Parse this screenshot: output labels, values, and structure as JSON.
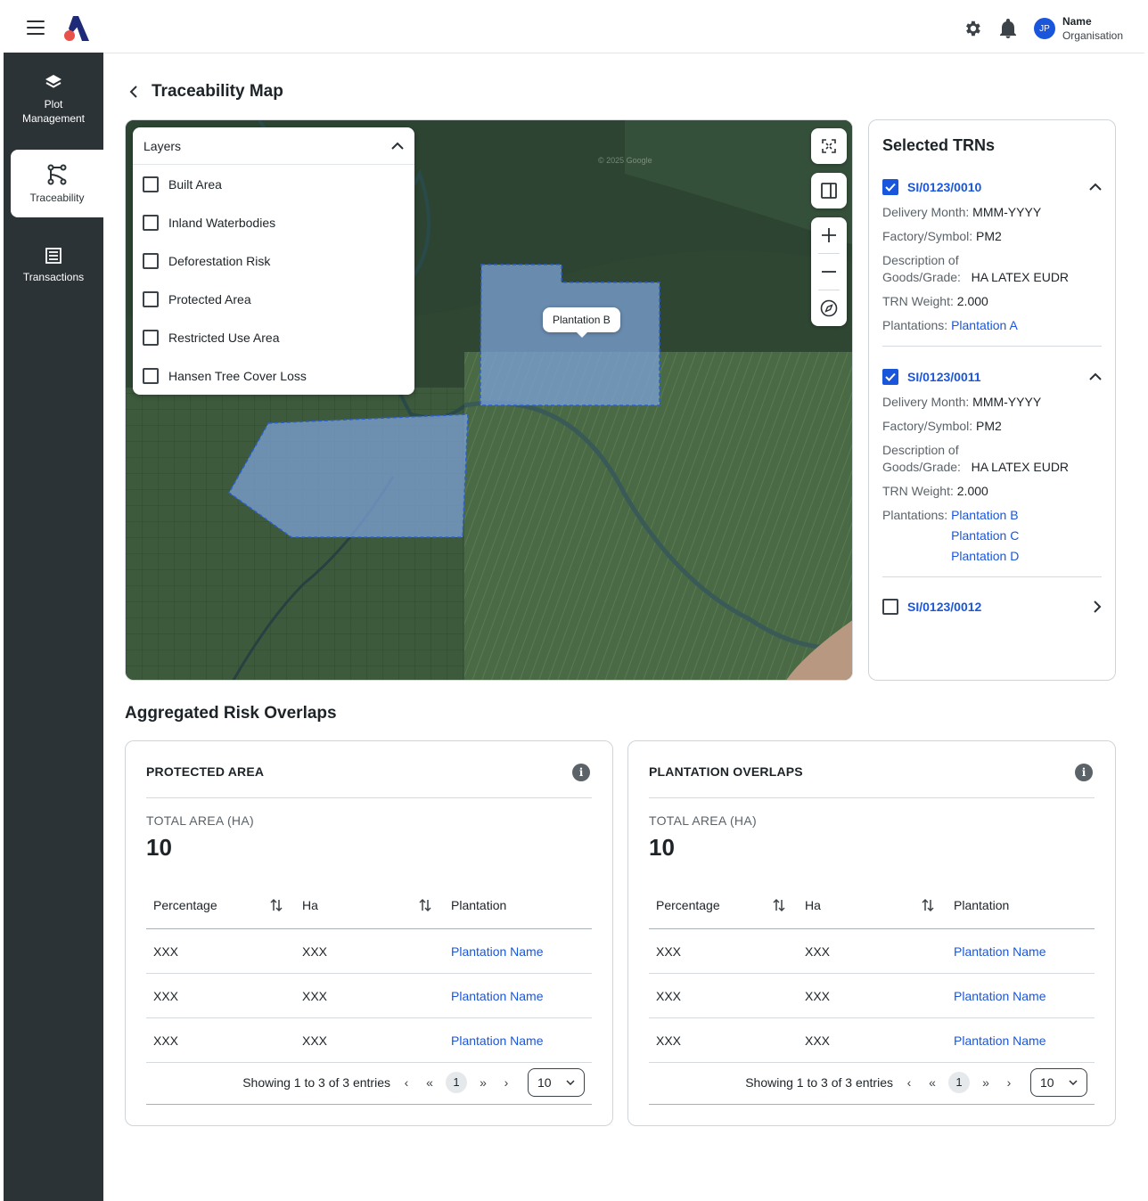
{
  "header": {
    "user_initials": "JP",
    "user_name": "Name",
    "user_org": "Organisation"
  },
  "sidebar": {
    "items": [
      {
        "label_1": "Plot",
        "label_2": "Management",
        "icon": "layers-icon"
      },
      {
        "label": "Traceability",
        "icon": "traceability-icon",
        "active": true
      },
      {
        "label": "Transactions",
        "icon": "transactions-icon"
      }
    ]
  },
  "page": {
    "title": "Traceability Map"
  },
  "map": {
    "layers_title": "Layers",
    "layers": [
      "Built Area",
      "Inland Waterbodies",
      "Deforestation Risk",
      "Protected Area",
      "Restricted Use Area",
      "Hansen Tree Cover Loss"
    ],
    "tooltip": "Plantation B",
    "watermark": "© 2025 Google"
  },
  "trns": {
    "title": "Selected TRNs",
    "items": [
      {
        "id": "SI/0123/0010",
        "checked": true,
        "expanded": true,
        "delivery_label": "Delivery Month:",
        "delivery": "MMM-YYYY",
        "factory_label": "Factory/Symbol:",
        "factory": "PM2",
        "desc_label_1": "Description of",
        "desc_label_2": "Goods/Grade:",
        "desc": "HA LATEX EUDR",
        "weight_label": "TRN Weight:",
        "weight": "2.000",
        "plantations_label": "Plantations:",
        "plantations": [
          "Plantation A"
        ]
      },
      {
        "id": "SI/0123/0011",
        "checked": true,
        "expanded": true,
        "delivery_label": "Delivery Month:",
        "delivery": "MMM-YYYY",
        "factory_label": "Factory/Symbol:",
        "factory": "PM2",
        "desc_label_1": "Description of",
        "desc_label_2": "Goods/Grade:",
        "desc": "HA LATEX EUDR",
        "weight_label": "TRN Weight:",
        "weight": "2.000",
        "plantations_label": "Plantations:",
        "plantations": [
          "Plantation B",
          "Plantation C",
          "Plantation D"
        ]
      },
      {
        "id": "SI/0123/0012",
        "checked": false,
        "expanded": false
      }
    ]
  },
  "aggregated": {
    "title": "Aggregated Risk Overlaps",
    "cards": [
      {
        "heading": "PROTECTED AREA",
        "total_label": "TOTAL AREA (HA)",
        "total": "10",
        "columns": [
          "Percentage",
          "Ha",
          "Plantation"
        ],
        "rows": [
          [
            "XXX",
            "XXX",
            "Plantation Name"
          ],
          [
            "XXX",
            "XXX",
            "Plantation Name"
          ],
          [
            "XXX",
            "XXX",
            "Plantation Name"
          ]
        ],
        "showing": "Showing 1 to 3 of 3 entries",
        "page": "1",
        "page_size": "10"
      },
      {
        "heading": "PLANTATION OVERLAPS",
        "total_label": "TOTAL AREA (HA)",
        "total": "10",
        "columns": [
          "Percentage",
          "Ha",
          "Plantation"
        ],
        "rows": [
          [
            "XXX",
            "XXX",
            "Plantation Name"
          ],
          [
            "XXX",
            "XXX",
            "Plantation Name"
          ],
          [
            "XXX",
            "XXX",
            "Plantation Name"
          ]
        ],
        "showing": "Showing 1 to 3 of 3 entries",
        "page": "1",
        "page_size": "10"
      }
    ]
  },
  "colors": {
    "accent": "#1a56db",
    "sidebar": "#2c3336",
    "polygon": "#7ea3d8"
  }
}
